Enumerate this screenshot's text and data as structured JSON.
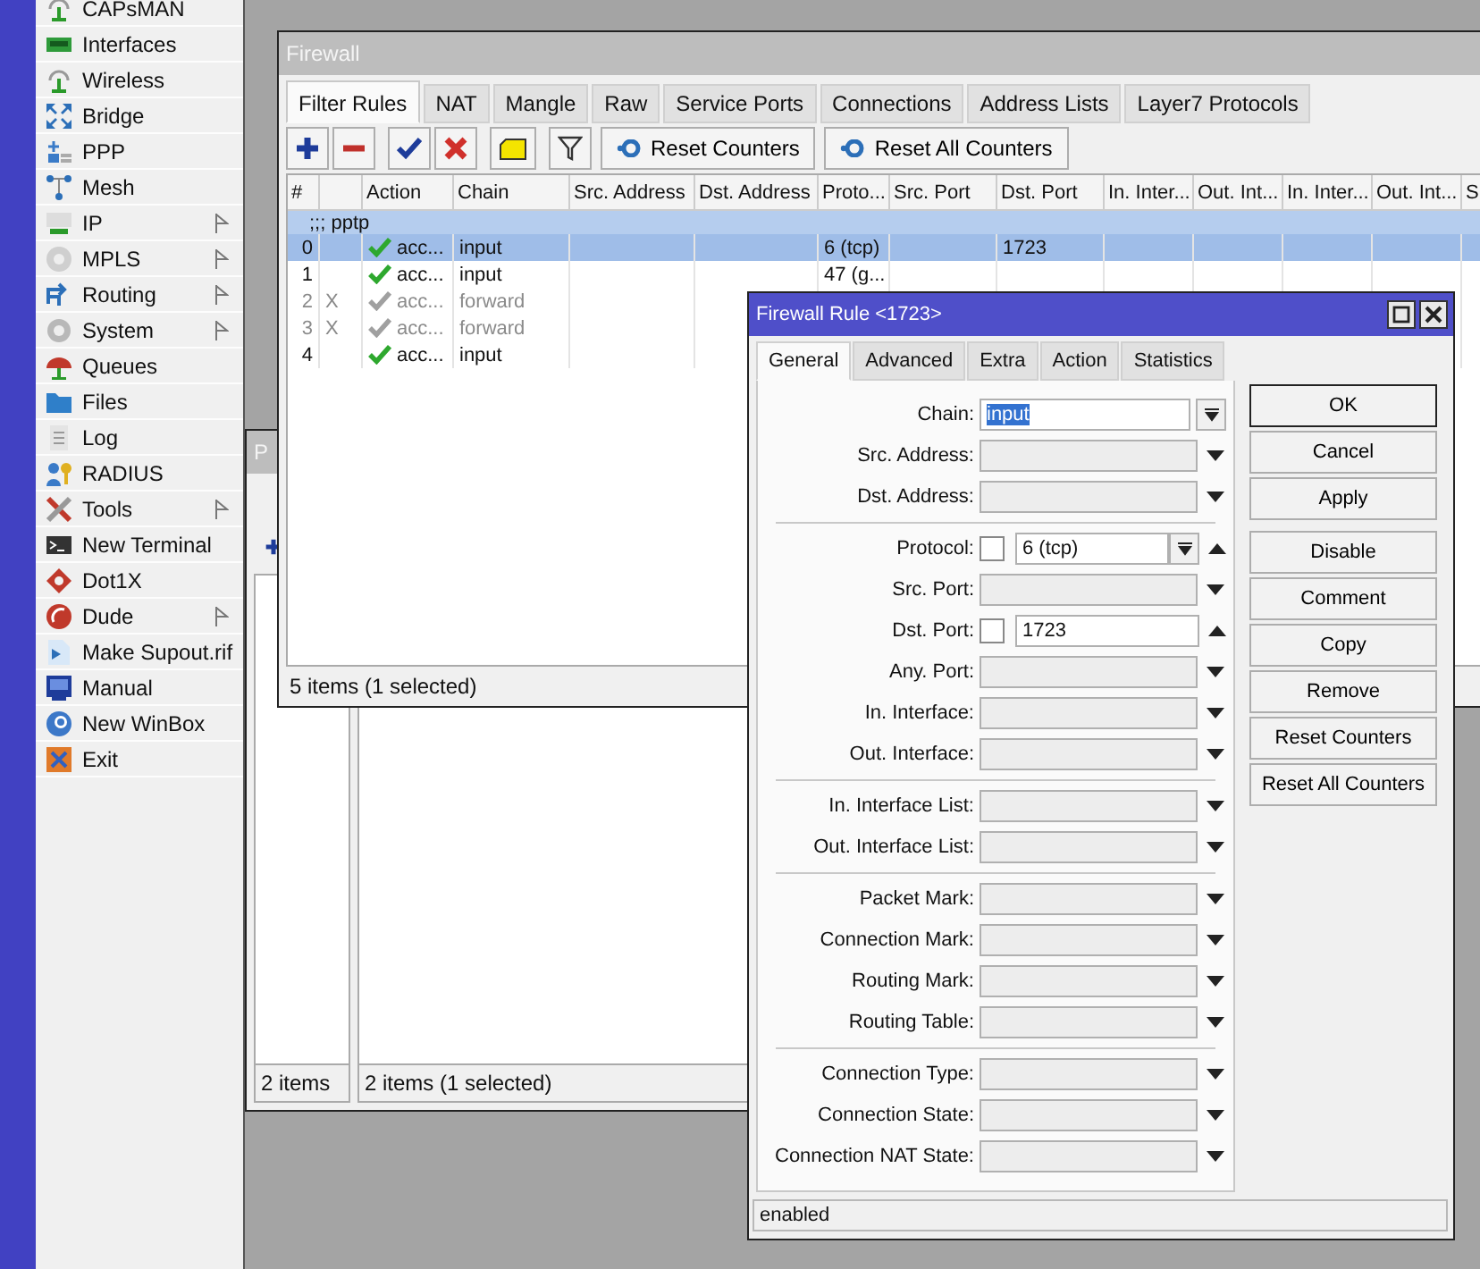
{
  "sidebar": {
    "items": [
      {
        "label": "CAPsMAN",
        "submenu": false
      },
      {
        "label": "Interfaces",
        "submenu": false
      },
      {
        "label": "Wireless",
        "submenu": false
      },
      {
        "label": "Bridge",
        "submenu": false
      },
      {
        "label": "PPP",
        "submenu": false
      },
      {
        "label": "Mesh",
        "submenu": false
      },
      {
        "label": "IP",
        "submenu": true
      },
      {
        "label": "MPLS",
        "submenu": true
      },
      {
        "label": "Routing",
        "submenu": true
      },
      {
        "label": "System",
        "submenu": true
      },
      {
        "label": "Queues",
        "submenu": false
      },
      {
        "label": "Files",
        "submenu": false
      },
      {
        "label": "Log",
        "submenu": false
      },
      {
        "label": "RADIUS",
        "submenu": false
      },
      {
        "label": "Tools",
        "submenu": true
      },
      {
        "label": "New Terminal",
        "submenu": false
      },
      {
        "label": "Dot1X",
        "submenu": false
      },
      {
        "label": "Dude",
        "submenu": true
      },
      {
        "label": "Make Supout.rif",
        "submenu": false
      },
      {
        "label": "Manual",
        "submenu": false
      },
      {
        "label": "New WinBox",
        "submenu": false
      },
      {
        "label": "Exit",
        "submenu": false
      }
    ]
  },
  "ppp_window": {
    "title": "P",
    "left_status": "2 items",
    "right_status": "2 items (1 selected)"
  },
  "firewall": {
    "title": "Firewall",
    "tabs": [
      {
        "label": "Filter Rules",
        "selected": true
      },
      {
        "label": "NAT",
        "selected": false
      },
      {
        "label": "Mangle",
        "selected": false
      },
      {
        "label": "Raw",
        "selected": false
      },
      {
        "label": "Service Ports",
        "selected": false
      },
      {
        "label": "Connections",
        "selected": false
      },
      {
        "label": "Address Lists",
        "selected": false
      },
      {
        "label": "Layer7 Protocols",
        "selected": false
      }
    ],
    "toolbar": {
      "buttons": [
        "Reset Counters",
        "Reset All Counters"
      ]
    },
    "table": {
      "columns": [
        "#",
        "",
        "Action",
        "Chain",
        "Src. Address",
        "Dst. Address",
        "Proto...",
        "Src. Port",
        "Dst. Port",
        "In. Inter...",
        "Out. Int...",
        "In. Inter...",
        "Out. Int...",
        "S"
      ],
      "comment": ";;; pptp",
      "rows": [
        {
          "number": "0",
          "action": "acc...",
          "chain": "input",
          "protocol": "6 (tcp)",
          "dst_port": "1723",
          "disabled": false,
          "selected": true
        },
        {
          "number": "1",
          "action": "acc...",
          "chain": "input",
          "protocol": "47 (g...",
          "disabled": false,
          "selected": false
        },
        {
          "number": "2",
          "flag": "X",
          "action": "acc...",
          "chain": "forward",
          "disabled": true,
          "selected": false
        },
        {
          "number": "3",
          "flag": "X",
          "action": "acc...",
          "chain": "forward",
          "disabled": true,
          "selected": false
        },
        {
          "number": "4",
          "action": "acc...",
          "chain": "input",
          "disabled": false,
          "selected": false
        }
      ]
    },
    "status": "5 items (1 selected)"
  },
  "rule_dialog": {
    "title": "Firewall Rule <1723>",
    "tabs": [
      {
        "label": "General",
        "selected": true
      },
      {
        "label": "Advanced",
        "selected": false
      },
      {
        "label": "Extra",
        "selected": false
      },
      {
        "label": "Action",
        "selected": false
      },
      {
        "label": "Statistics",
        "selected": false
      }
    ],
    "groups": [
      [
        {
          "label": "Chain:",
          "kind": "combo",
          "value": "input",
          "highlighted": true
        },
        {
          "label": "Src. Address:",
          "kind": "dropdown"
        },
        {
          "label": "Dst. Address:",
          "kind": "dropdown"
        }
      ],
      [
        {
          "label": "Protocol:",
          "kind": "check_combo",
          "value": "6 (tcp)",
          "negated": false
        },
        {
          "label": "Src. Port:",
          "kind": "dropdown"
        },
        {
          "label": "Dst. Port:",
          "kind": "check_text",
          "value": "1723",
          "negated": false
        },
        {
          "label": "Any. Port:",
          "kind": "dropdown"
        },
        {
          "label": "In. Interface:",
          "kind": "dropdown"
        },
        {
          "label": "Out. Interface:",
          "kind": "dropdown"
        }
      ],
      [
        {
          "label": "In. Interface List:",
          "kind": "dropdown"
        },
        {
          "label": "Out. Interface List:",
          "kind": "dropdown"
        }
      ],
      [
        {
          "label": "Packet Mark:",
          "kind": "dropdown"
        },
        {
          "label": "Connection Mark:",
          "kind": "dropdown"
        },
        {
          "label": "Routing Mark:",
          "kind": "dropdown"
        },
        {
          "label": "Routing Table:",
          "kind": "dropdown"
        }
      ],
      [
        {
          "label": "Connection Type:",
          "kind": "dropdown"
        },
        {
          "label": "Connection State:",
          "kind": "dropdown"
        },
        {
          "label": "Connection NAT State:",
          "kind": "dropdown"
        }
      ]
    ],
    "buttons": [
      [
        {
          "label": "OK",
          "default": true
        },
        {
          "label": "Cancel",
          "default": false
        },
        {
          "label": "Apply",
          "default": false
        }
      ],
      [
        {
          "label": "Disable",
          "default": false
        },
        {
          "label": "Comment",
          "default": false
        },
        {
          "label": "Copy",
          "default": false
        },
        {
          "label": "Remove",
          "default": false
        },
        {
          "label": "Reset Counters",
          "default": false
        },
        {
          "label": "Reset All Counters",
          "default": false
        }
      ]
    ],
    "status": "enabled"
  }
}
